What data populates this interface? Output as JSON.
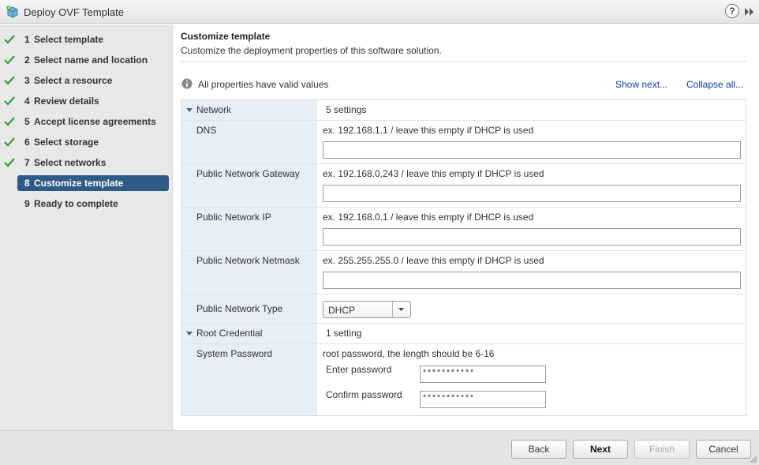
{
  "window": {
    "title": "Deploy OVF Template",
    "help_label": "?"
  },
  "steps": [
    {
      "num": "1",
      "label": "Select template",
      "done": true
    },
    {
      "num": "2",
      "label": "Select name and location",
      "done": true
    },
    {
      "num": "3",
      "label": "Select a resource",
      "done": true
    },
    {
      "num": "4",
      "label": "Review details",
      "done": true
    },
    {
      "num": "5",
      "label": "Accept license agreements",
      "done": true
    },
    {
      "num": "6",
      "label": "Select storage",
      "done": true
    },
    {
      "num": "7",
      "label": "Select networks",
      "done": true
    },
    {
      "num": "8",
      "label": "Customize template",
      "done": false,
      "active": true
    },
    {
      "num": "9",
      "label": "Ready to complete",
      "done": false
    }
  ],
  "content": {
    "title": "Customize template",
    "subtitle": "Customize the deployment properties of this software solution.",
    "info": "All properties have valid values",
    "show_next": "Show next...",
    "collapse_all": "Collapse all..."
  },
  "network": {
    "label": "Network",
    "count": "5 settings",
    "dns": {
      "label": "DNS",
      "hint": "ex. 192.168.1.1 / leave this empty if DHCP is used",
      "value": ""
    },
    "gateway": {
      "label": "Public Network Gateway",
      "hint": "ex. 192.168.0.243 / leave this empty if DHCP is used",
      "value": ""
    },
    "ip": {
      "label": "Public Network IP",
      "hint": "ex. 192.168.0.1 / leave this empty if DHCP is used",
      "value": ""
    },
    "netmask": {
      "label": "Public Network Netmask",
      "hint": "ex. 255.255.255.0 / leave this empty if DHCP is used",
      "value": ""
    },
    "type": {
      "label": "Public Network Type",
      "value": "DHCP"
    }
  },
  "root": {
    "label": "Root Credential",
    "count": "1 setting",
    "password": {
      "label": "System Password",
      "hint": "root password, the length should be 6-16",
      "enter_label": "Enter password",
      "enter_value": "***********",
      "confirm_label": "Confirm password",
      "confirm_value": "***********"
    }
  },
  "buttons": {
    "back": "Back",
    "next": "Next",
    "finish": "Finish",
    "cancel": "Cancel"
  },
  "colors": {
    "active_step": "#2f5b88",
    "check": "#3a9a3a",
    "link": "#0b3d9e",
    "key_column": "#e6eef6"
  }
}
